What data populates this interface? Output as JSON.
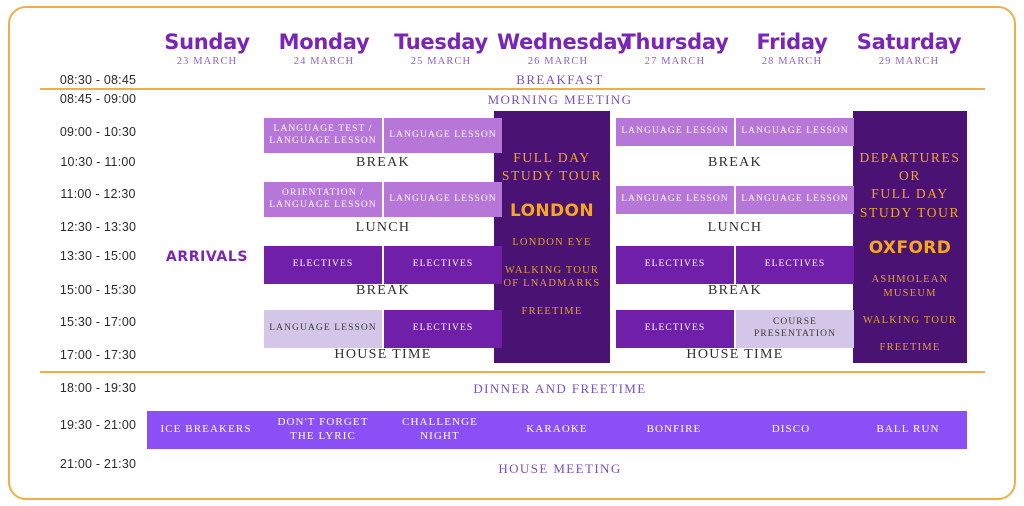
{
  "theme": {
    "frame_border": "#f0ae48",
    "purple_dark": "#4a1272",
    "purple_mid": "#7020a8",
    "purple_light": "#b777d8",
    "purple_pale": "#d4c6e8",
    "violet_evening": "#8a4ff5",
    "gold": "#f5a81c",
    "heading_purple": "#7b25b5"
  },
  "days": [
    {
      "name": "Sunday",
      "date": "23 MARCH"
    },
    {
      "name": "Monday",
      "date": "24 MARCH"
    },
    {
      "name": "Tuesday",
      "date": "25 MARCH"
    },
    {
      "name": "Wednesday",
      "date": "26 MARCH"
    },
    {
      "name": "Thursday",
      "date": "27 MARCH"
    },
    {
      "name": "Friday",
      "date": "28 MARCH"
    },
    {
      "name": "Saturday",
      "date": "29 MARCH"
    }
  ],
  "times": [
    "08:30 - 08:45",
    "08:45 - 09:00",
    "09:00 - 10:30",
    "10:30 - 11:00",
    "11:00 - 12:30",
    "12:30 - 13:30",
    "13:30 - 15:00",
    "15:00 - 15:30",
    "15:30 - 17:00",
    "17:00 - 17:30",
    "18:00 - 19:30",
    "19:30 - 21:00",
    "21:00 - 21:30"
  ],
  "bands": {
    "breakfast": "BREAKFAST",
    "morning_meeting": "MORNING MEETING",
    "dinner": "DINNER AND FREETIME",
    "house_meeting": "HOUSE MEETING"
  },
  "arrivals": "ARRIVALS",
  "breaks": {
    "break_morning": "BREAK",
    "lunch": "LUNCH",
    "break_afternoon": "BREAK",
    "house_time": "HOUSE TIME"
  },
  "lessons": {
    "mon_0900": "LANGUAGE TEST /\nLANGUAGE LESSON",
    "tue_0900": "LANGUAGE LESSON",
    "mon_1100": "ORIENTATION /\nLANGUAGE LESSON",
    "tue_1100": "LANGUAGE LESSON",
    "mon_1330": "ELECTIVES",
    "tue_1330": "ELECTIVES",
    "mon_1530": "LANGUAGE LESSON",
    "tue_1530": "ELECTIVES",
    "thu_0900": "LANGUAGE LESSON",
    "fri_0900": "LANGUAGE LESSON",
    "thu_1100": "LANGUAGE LESSON",
    "fri_1100": "LANGUAGE LESSON",
    "thu_1330": "ELECTIVES",
    "fri_1330": "ELECTIVES",
    "thu_1530": "ELECTIVES",
    "fri_1530": "COURSE\nPRESENTATION"
  },
  "tours": {
    "wednesday": {
      "title": "FULL DAY\nSTUDY TOUR",
      "city": "LONDON",
      "items": "LONDON EYE\n\nWALKING TOUR\nOF LNADMARKS\n\nFREETIME"
    },
    "saturday": {
      "title": "DEPARTURES\nOR\nFULL DAY\nSTUDY TOUR",
      "city": "OXFORD",
      "items": "ASHMOLEAN\nMUSEUM\n\nWALKING TOUR\n\nFREETIME"
    }
  },
  "evening": [
    "ICE BREAKERS",
    "DON'T FORGET\nTHE LYRIC",
    "CHALLENGE\nNIGHT",
    "KARAOKE",
    "BONFIRE",
    "DISCO",
    "BALL RUN"
  ]
}
